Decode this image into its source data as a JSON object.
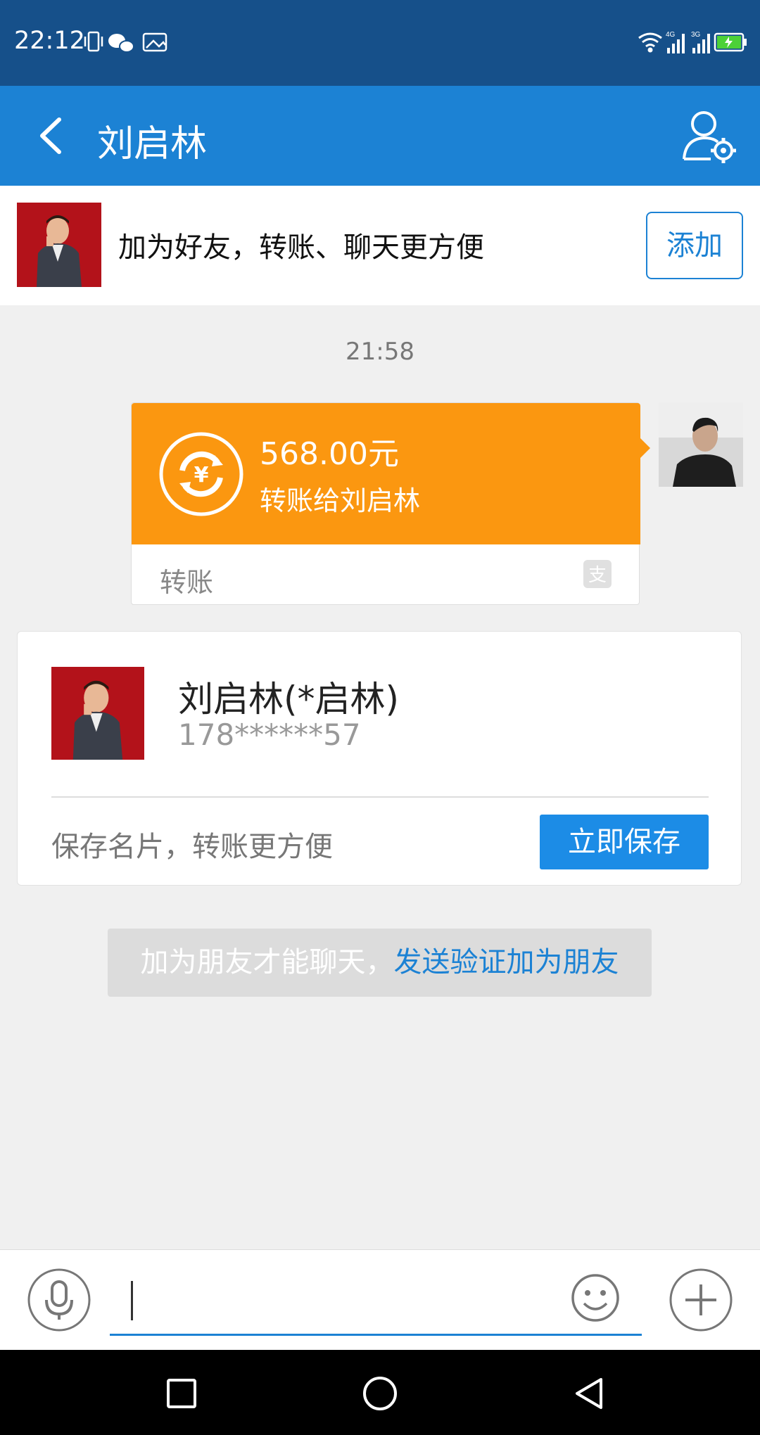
{
  "status_bar": {
    "time": "22:12",
    "network_1": "4G",
    "network_2": "3G"
  },
  "header": {
    "title": "刘启林",
    "back_icon": "chevron-left-icon",
    "settings_icon": "person-settings-icon"
  },
  "add_friend_banner": {
    "text": "加为好友，转账、聊天更方便",
    "button": "添加"
  },
  "messages": {
    "timestamp": "21:58",
    "transfer": {
      "amount": "568.00元",
      "description": "转账给刘启林",
      "label": "转账",
      "icon": "yuan-refresh-icon"
    }
  },
  "contact_card": {
    "name": "刘启林(*启林)",
    "phone": "178******57",
    "hint": "保存名片，转账更方便",
    "save_button": "立即保存"
  },
  "system_notice": {
    "text": "加为朋友才能聊天，",
    "link": "发送验证加为朋友"
  },
  "input_bar": {
    "placeholder": ""
  },
  "colors": {
    "status_bar": "#16508a",
    "title_bar": "#1c82d4",
    "transfer": "#fb9710",
    "save_button": "#1c8ce6"
  }
}
